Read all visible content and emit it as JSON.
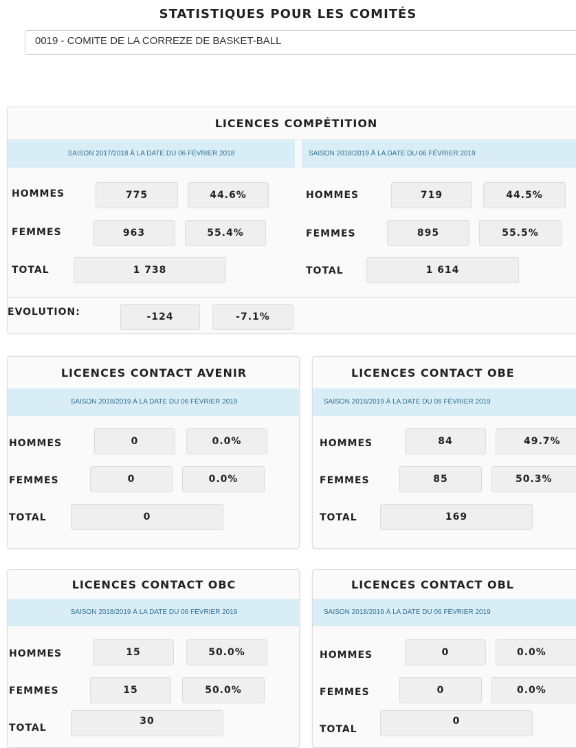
{
  "page_title": "STATISTIQUES POUR LES COMITÉS",
  "committee_select": {
    "selected": "0019 - COMITE DE LA CORREZE DE BASKET-BALL"
  },
  "competition": {
    "title": "LICENCES COMPÉTITION",
    "season_a": {
      "label": "SAISON 2017/2018 À LA DATE DU 06 FÉVRIER 2018",
      "hommes_label": "HOMMES",
      "hommes_count": "775",
      "hommes_pct": "44.6%",
      "femmes_label": "FEMMES",
      "femmes_count": "963",
      "femmes_pct": "55.4%",
      "total_label": "TOTAL",
      "total": "1 738"
    },
    "season_b": {
      "label": "SAISON 2018/2019 À LA DATE DU 06 FÉVRIER 2019",
      "hommes_label": "HOMMES",
      "hommes_count": "719",
      "hommes_pct": "44.5%",
      "femmes_label": "FEMMES",
      "femmes_count": "895",
      "femmes_pct": "55.5%",
      "total_label": "TOTAL",
      "total": "1 614"
    },
    "evolution_label": "EVOLUTION:",
    "evolution_value": "-124",
    "evolution_pct": "-7.1%"
  },
  "avenir": {
    "title": "LICENCES CONTACT AVENIR",
    "season": "SAISON 2018/2019 À LA DATE DU 06 FÉVRIER 2019",
    "hommes_label": "HOMMES",
    "hommes_count": "0",
    "hommes_pct": "0.0%",
    "femmes_label": "FEMMES",
    "femmes_count": "0",
    "femmes_pct": "0.0%",
    "total_label": "TOTAL",
    "total": "0"
  },
  "obe": {
    "title": "LICENCES CONTACT OBE",
    "season": "SAISON 2018/2019 À LA DATE DU 06 FÉVRIER 2019",
    "hommes_label": "HOMMES",
    "hommes_count": "84",
    "hommes_pct": "49.7%",
    "femmes_label": "FEMMES",
    "femmes_count": "85",
    "femmes_pct": "50.3%",
    "total_label": "TOTAL",
    "total": "169"
  },
  "obc": {
    "title": "LICENCES CONTACT OBC",
    "season": "SAISON 2018/2019 À LA DATE DU 06 FÉVRIER 2019",
    "hommes_label": "HOMMES",
    "hommes_count": "15",
    "hommes_pct": "50.0%",
    "femmes_label": "FEMMES",
    "femmes_count": "15",
    "femmes_pct": "50.0%",
    "total_label": "TOTAL",
    "total": "30"
  },
  "obl": {
    "title": "LICENCES CONTACT OBL",
    "season": "SAISON 2018/2019 À LA DATE DU 06 FÉVRIER 2019",
    "hommes_label": "HOMMES",
    "hommes_count": "0",
    "hommes_pct": "0.0%",
    "femmes_label": "FEMMES",
    "femmes_count": "0",
    "femmes_pct": "0.0%",
    "total_label": "TOTAL",
    "total": "0"
  }
}
